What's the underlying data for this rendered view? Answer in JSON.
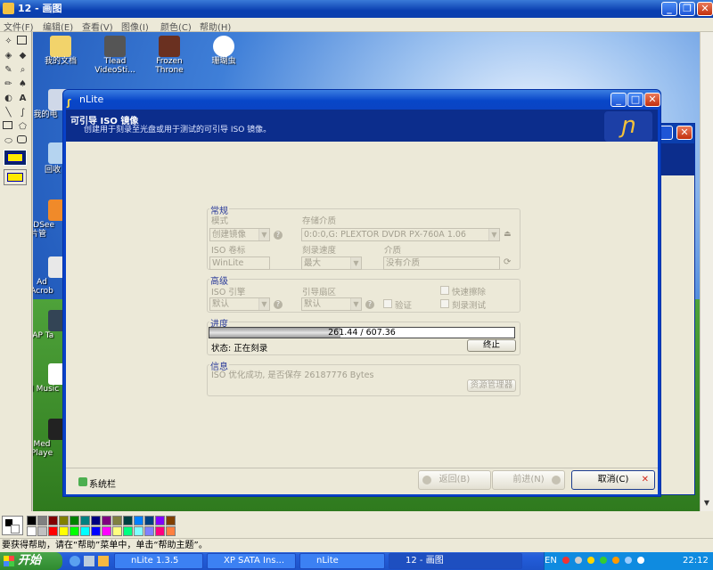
{
  "paint": {
    "title": "12 - 画图",
    "menus": [
      "文件(F)",
      "编辑(E)",
      "查看(V)",
      "图像(I)",
      "颜色(C)",
      "帮助(H)"
    ],
    "status_text": "要获得帮助，请在“帮助”菜单中，单击“帮助主题”。",
    "palette_colors": [
      "#000000",
      "#808080",
      "#800000",
      "#808000",
      "#008000",
      "#008080",
      "#000080",
      "#800080",
      "#808040",
      "#004040",
      "#0080ff",
      "#004080",
      "#8000ff",
      "#804000",
      "#ffffff",
      "#c0c0c0",
      "#ff0000",
      "#ffff00",
      "#00ff00",
      "#00ffff",
      "#0000ff",
      "#ff00ff",
      "#ffff80",
      "#00ff80",
      "#80ffff",
      "#8080ff",
      "#ff0080",
      "#ff8040"
    ]
  },
  "desktop": {
    "icons_top": [
      {
        "label": "我的文档",
        "icon": "folder-icon"
      },
      {
        "label": "Tlead VideoSti...",
        "icon": "video-icon"
      },
      {
        "label": "Frozen Throne",
        "icon": "game-icon"
      },
      {
        "label": "珊瑚虫",
        "icon": "qq-penguin-icon"
      }
    ],
    "icons_left": [
      {
        "label": "我的电",
        "icon": "computer-icon"
      },
      {
        "label": "回收",
        "icon": "recycle-bin-icon"
      },
      {
        "label": "ACDSee 片管",
        "icon": "acdsee-icon"
      },
      {
        "label": "Ad Acrob",
        "icon": "acrobat-icon"
      },
      {
        "label": "UAP Ta",
        "icon": "app-icon"
      },
      {
        "label": "Lil Music",
        "icon": "music-icon"
      },
      {
        "label": "Med Playe",
        "icon": "media-player-icon"
      }
    ]
  },
  "nlite": {
    "title": "nLite",
    "header_title": "可引导 ISO 镜像",
    "header_subtitle": "创建用于刻录至光盘或用于测试的可引导 ISO 镜像。",
    "general": {
      "title": "常规",
      "mode_label": "模式",
      "mode_value": "创建镜像",
      "media_label": "存储介质",
      "media_value": "0:0:0,G: PLEXTOR  DVDR   PX-760A   1.06",
      "iso_label_label": "ISO 卷标",
      "iso_label_value": "WinLite",
      "speed_label": "刻录速度",
      "speed_value": "最大",
      "medium_label": "介质",
      "medium_value": "没有介质"
    },
    "advanced": {
      "title": "高级",
      "engine_label": "ISO 引擎",
      "engine_value": "默认",
      "boot_label": "引导扇区",
      "boot_value": "默认",
      "verify_label": "验证",
      "quick_erase_label": "快速擦除",
      "test_burn_label": "刻录测试"
    },
    "progress": {
      "title": "进度",
      "text": "261.44 / 607.36",
      "fraction": 0.43,
      "status": "状态: 正在刻录",
      "stop_label": "终止"
    },
    "info": {
      "title": "信息",
      "text": "ISO 优化成功, 是否保存 26187776 Bytes",
      "explorer_label": "资源管理器"
    },
    "footer": {
      "tray_label": "系统栏",
      "back_label": "返回(B)",
      "next_label": "前进(N)",
      "cancel_label": "取消(C)"
    }
  },
  "taskbar": {
    "start_label": "开始",
    "tasks": [
      "nLite 1.3.5",
      "XP SATA Ins...",
      "nLite",
      "12 - 画图"
    ],
    "lang": "EN",
    "clock": "22:12"
  }
}
